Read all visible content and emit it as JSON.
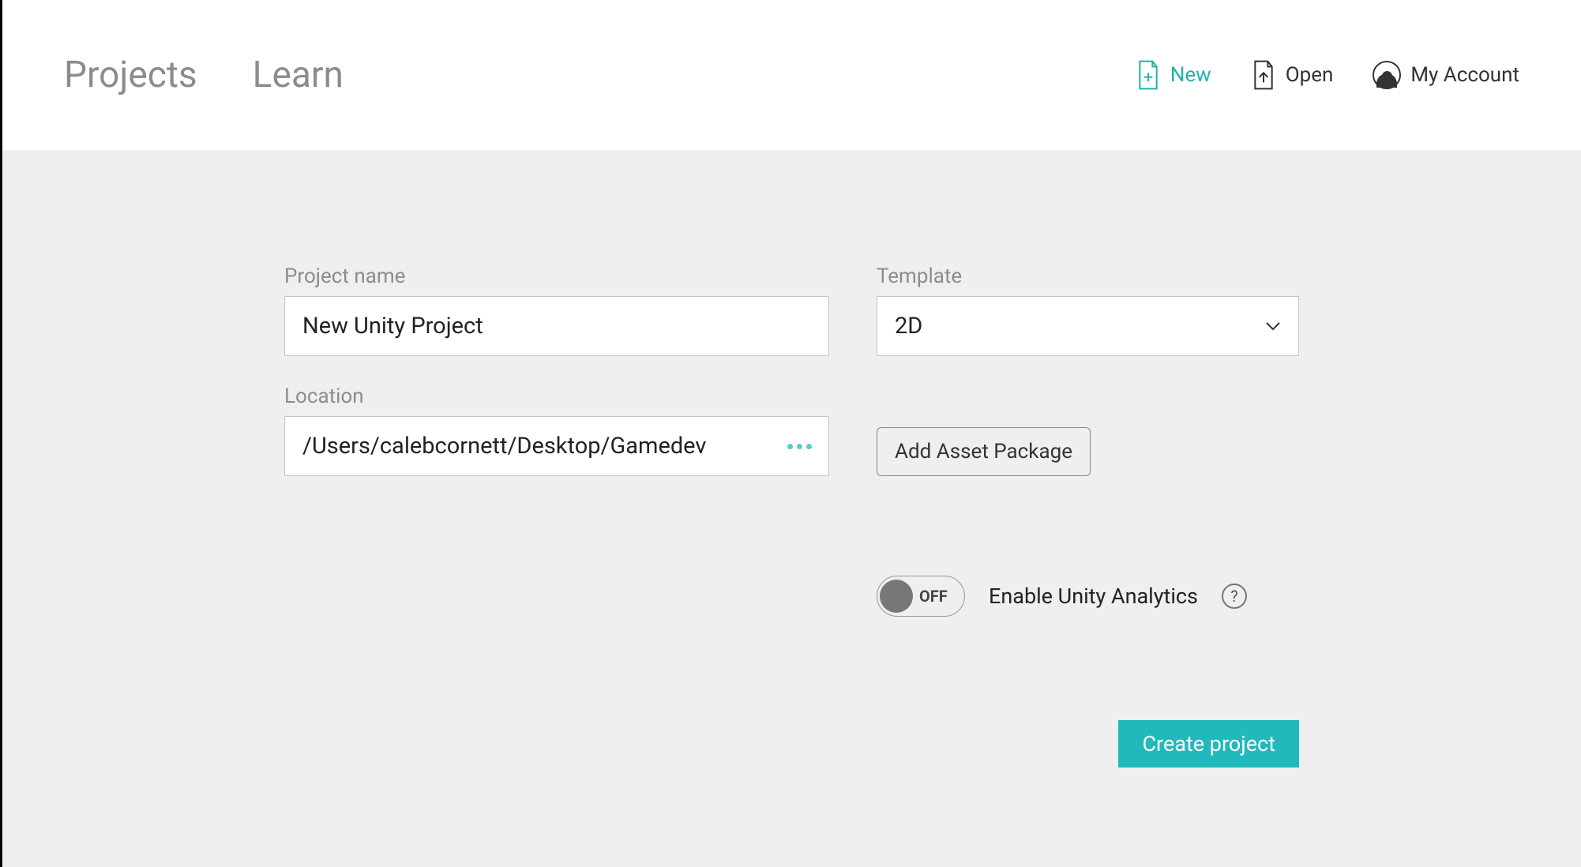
{
  "header": {
    "tabs": {
      "projects": "Projects",
      "learn": "Learn"
    },
    "actions": {
      "new": "New",
      "open": "Open",
      "account": "My Account"
    }
  },
  "form": {
    "project_name": {
      "label": "Project name",
      "value": "New Unity Project"
    },
    "template": {
      "label": "Template",
      "value": "2D"
    },
    "location": {
      "label": "Location",
      "value": "/Users/calebcornett/Desktop/Gamedev"
    },
    "add_asset_package": "Add Asset Package",
    "analytics": {
      "toggle_state": "OFF",
      "label": "Enable Unity Analytics",
      "help": "?"
    },
    "create": "Create project"
  }
}
